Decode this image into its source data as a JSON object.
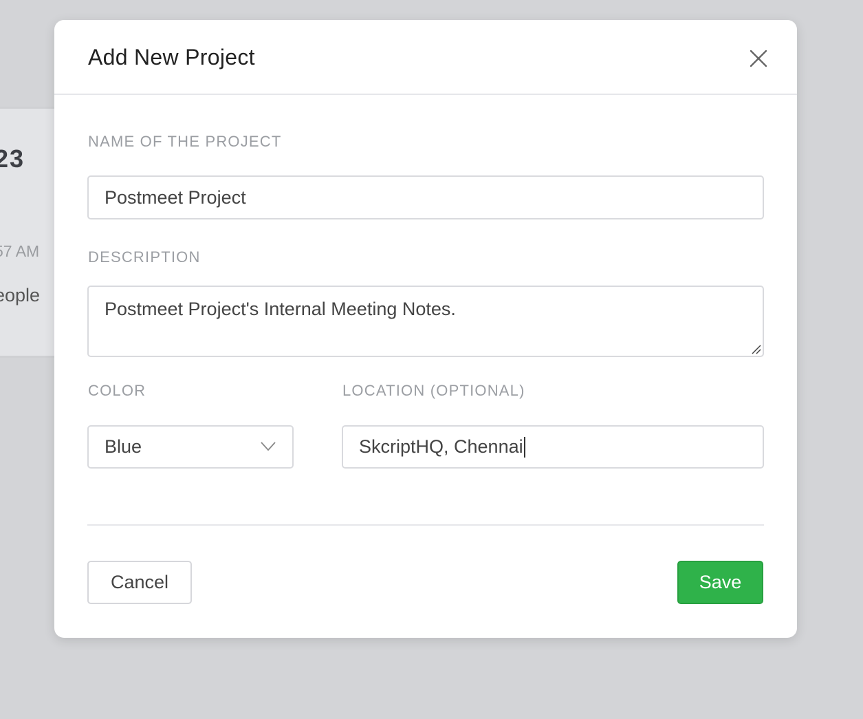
{
  "background": {
    "number": "23",
    "time": "57 AM",
    "people": "eople"
  },
  "modal": {
    "title": "Add New Project",
    "close_icon": "close-icon"
  },
  "form": {
    "name": {
      "label": "NAME OF THE PROJECT",
      "value": "Postmeet Project"
    },
    "description": {
      "label": "DESCRIPTION",
      "value": "Postmeet Project's Internal Meeting Notes."
    },
    "color": {
      "label": "COLOR",
      "value": "Blue"
    },
    "location": {
      "label": "LOCATION (OPTIONAL)",
      "value": "SkcriptHQ, Chennai"
    }
  },
  "footer": {
    "cancel_label": "Cancel",
    "save_label": "Save"
  },
  "colors": {
    "save_bg": "#2fb24a",
    "overlay": "#d3d4d7"
  }
}
